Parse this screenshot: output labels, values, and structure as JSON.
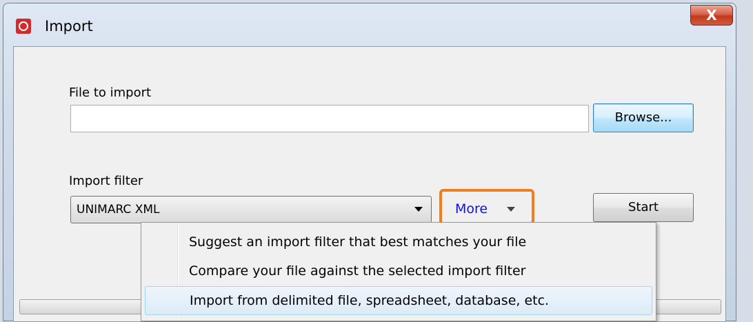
{
  "window": {
    "title": "Import",
    "close_label": "X"
  },
  "file_section": {
    "label": "File to import",
    "value": "",
    "browse_label": "Browse..."
  },
  "filter_section": {
    "label": "Import filter",
    "selected": "UNIMARC XML",
    "more_label": "More",
    "start_label": "Start"
  },
  "more_menu": {
    "items": [
      "Suggest an import filter that best matches your file",
      "Compare your file against the selected import filter",
      "Import from delimited file, spreadsheet, database, etc."
    ],
    "hovered_index": 2
  },
  "colors": {
    "highlight": "#f07e1e",
    "link": "#1010e0",
    "app_icon": "#d32b2b"
  }
}
